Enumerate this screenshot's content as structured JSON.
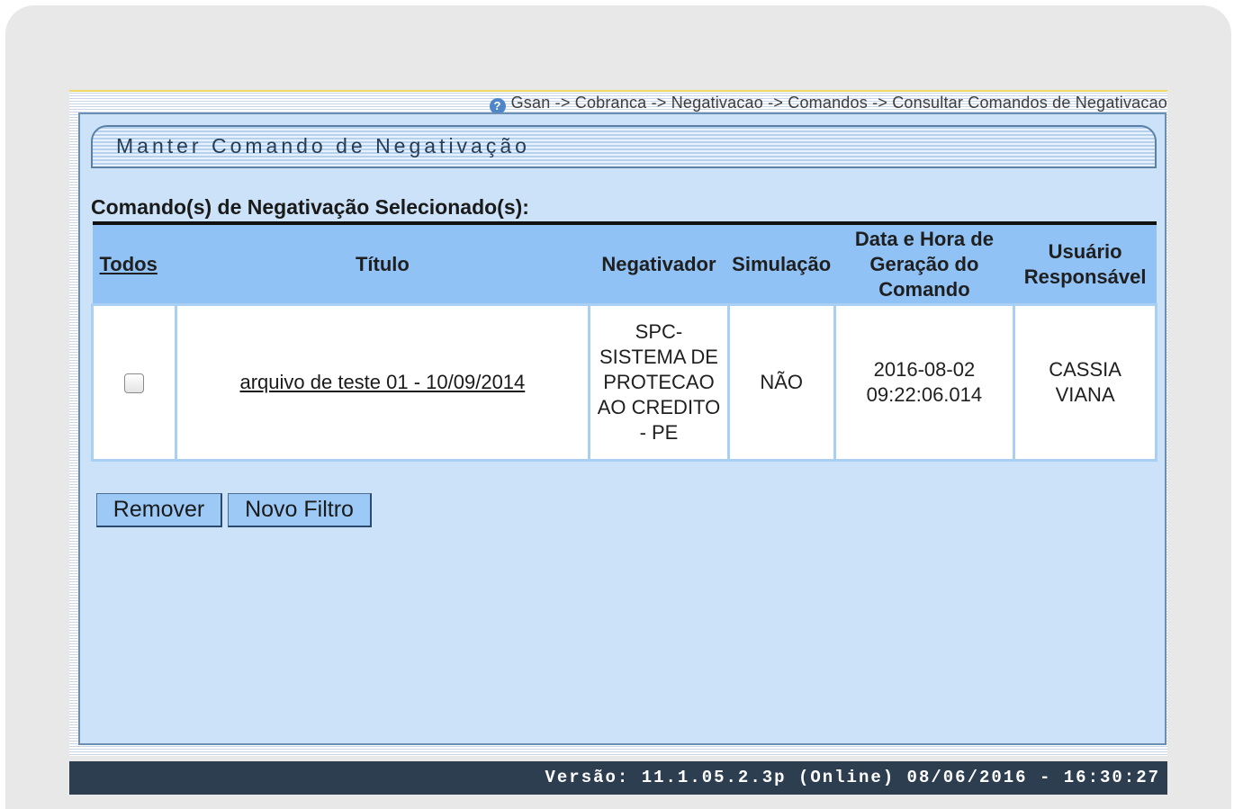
{
  "breadcrumb": "Gsan -> Cobranca -> Negativacao -> Comandos -> Consultar Comandos de Negativacao",
  "page_title": "Manter Comando de Negativação",
  "section_label": "Comando(s) de Negativação Selecionado(s):",
  "table": {
    "headers": {
      "todos": "Todos",
      "titulo": "Título",
      "negativador": "Negativador",
      "simulacao": "Simulação",
      "data_hora": "Data e Hora de Geração do Comando",
      "usuario": "Usuário Responsável"
    },
    "rows": [
      {
        "checked": false,
        "titulo": "arquivo de teste 01 - 10/09/2014",
        "negativador": "SPC-SISTEMA DE PROTECAO AO CREDITO - PE",
        "simulacao": "NÃO",
        "data_hora": "2016-08-02 09:22:06.014",
        "usuario": "CASSIA VIANA"
      }
    ]
  },
  "buttons": {
    "remover": "Remover",
    "novo_filtro": "Novo Filtro"
  },
  "footer": "Versão: 11.1.05.2.3p (Online) 08/06/2016 - 16:30:27"
}
